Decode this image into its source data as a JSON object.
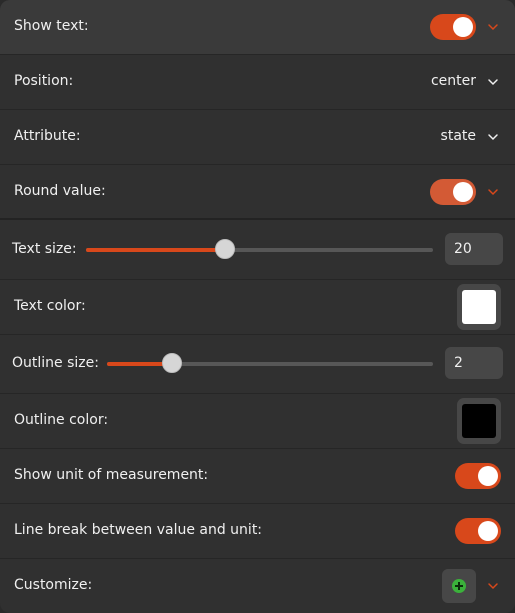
{
  "accent_color": "#d8481b",
  "rows": {
    "show_text": {
      "label": "Show text:",
      "toggle_on": true
    },
    "position": {
      "label": "Position:",
      "value": "center"
    },
    "attribute": {
      "label": "Attribute:",
      "value": "state"
    },
    "round_value": {
      "label": "Round value:",
      "toggle_on": true
    },
    "text_size": {
      "label": "Text size:",
      "value": "20",
      "slider_fraction": 0.4
    },
    "text_color": {
      "label": "Text color:",
      "color": "#ffffff"
    },
    "outline_size": {
      "label": "Outline size:",
      "value": "2",
      "slider_fraction": 0.2
    },
    "outline_color": {
      "label": "Outline color:",
      "color": "#000000"
    },
    "show_unit": {
      "label": "Show unit of measurement:",
      "toggle_on": true
    },
    "line_break": {
      "label": "Line break between value and unit:",
      "toggle_on": true
    },
    "customize": {
      "label": "Customize:",
      "icon": "add-icon"
    }
  }
}
